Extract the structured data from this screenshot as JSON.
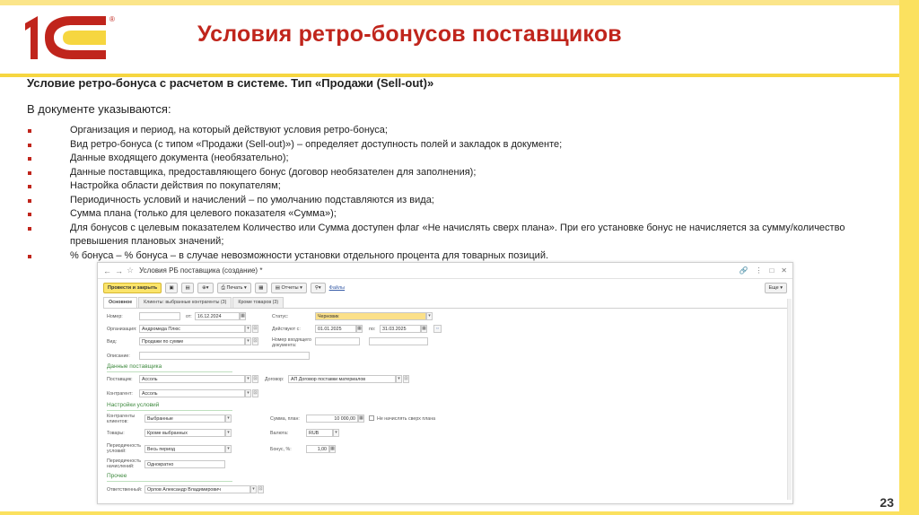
{
  "slide": {
    "title": "Условия ретро-бонусов поставщиков",
    "subtitle": "Условие ретро-бонуса с расчетом в системе. Тип «Продажи (Sell-out)»",
    "intro": "В документе указываются:",
    "page_number": "23",
    "logo": {
      "text": "1С",
      "registered": "®",
      "colors": {
        "red": "#c0251c",
        "yellow": "#f6d640"
      }
    },
    "accent_color": "#c0251c",
    "bullets": [
      "Организация и период, на который действуют условия ретро-бонуса;",
      "Вид ретро-бонуса (с типом «Продажи (Sell-out)») – определяет доступность полей и закладок в документе;",
      "Данные входящего документа (необязательно);",
      "Данные поставщика, предоставляющего бонус (договор необязателен для заполнения);",
      "Настройка области действия по покупателям;",
      "Периодичность условий и начислений – по умолчанию подставляются из вида;",
      "Сумма плана (только для целевого показателя «Сумма»);",
      "Для бонусов с целевым показателем Количество или Сумма доступен флаг «Не начислять сверх плана». При его установке бонус не начисляется за сумму/количество превышения плановых значений;",
      "% бонуса – % бонуса – в случае невозможности установки отдельного процента для товарных позиций."
    ]
  },
  "window": {
    "title": "Условия РБ поставщика (создание) *",
    "toolbar": {
      "post_close": "Провести и закрыть",
      "print": "Печать",
      "reports": "Отчеты",
      "files": "Файлы",
      "more": "Еще"
    },
    "tabs": [
      "Основное",
      "Клиенты: выбранные контрагенты (3)",
      "Кроме товаров (3)"
    ],
    "form": {
      "number_label": "Номер:",
      "number_value": "",
      "from_label": "от:",
      "date_value": "16.12.2024",
      "status_label": "Статус:",
      "status_value": "Черновик",
      "org_label": "Организация:",
      "org_value": "Андромеда Плюс",
      "valid_label": "Действуют с:",
      "valid_from": "01.01.2025",
      "to_label": "по:",
      "valid_to": "31.03.2025",
      "kind_label": "Вид:",
      "kind_value": "Продажи по сумме",
      "incoming_label": "Номер входящего документа:",
      "description_label": "Описание:",
      "supplier_section": "Данные поставщика",
      "supplier_label": "Поставщик:",
      "supplier_value": "Ассоль",
      "contract_label": "Договор:",
      "contract_value": "АП Договор поставки материалов",
      "counterparty_label": "Контрагент:",
      "counterparty_value": "Ассоль",
      "settings_section": "Настройки условий",
      "clients_label": "Контрагенты клиентов:",
      "clients_value": "Выбранные",
      "plan_label": "Сумма, план:",
      "plan_value": "10 000,00",
      "no_accrual_label": "Не начислять сверх плана",
      "goods_label": "Товары:",
      "goods_value": "Кроме выбранных",
      "currency_label": "Валюта:",
      "currency_value": "RUB",
      "period_label": "Периодичность условий:",
      "period_value": "Весь период",
      "bonus_label": "Бонус, %:",
      "bonus_value": "1,00",
      "accrual_label": "Периодичность начислений:",
      "accrual_value": "Однократно",
      "other_section": "Прочее",
      "responsible_label": "Ответственный:",
      "responsible_value": "Орлов Александр Владимирович"
    }
  }
}
